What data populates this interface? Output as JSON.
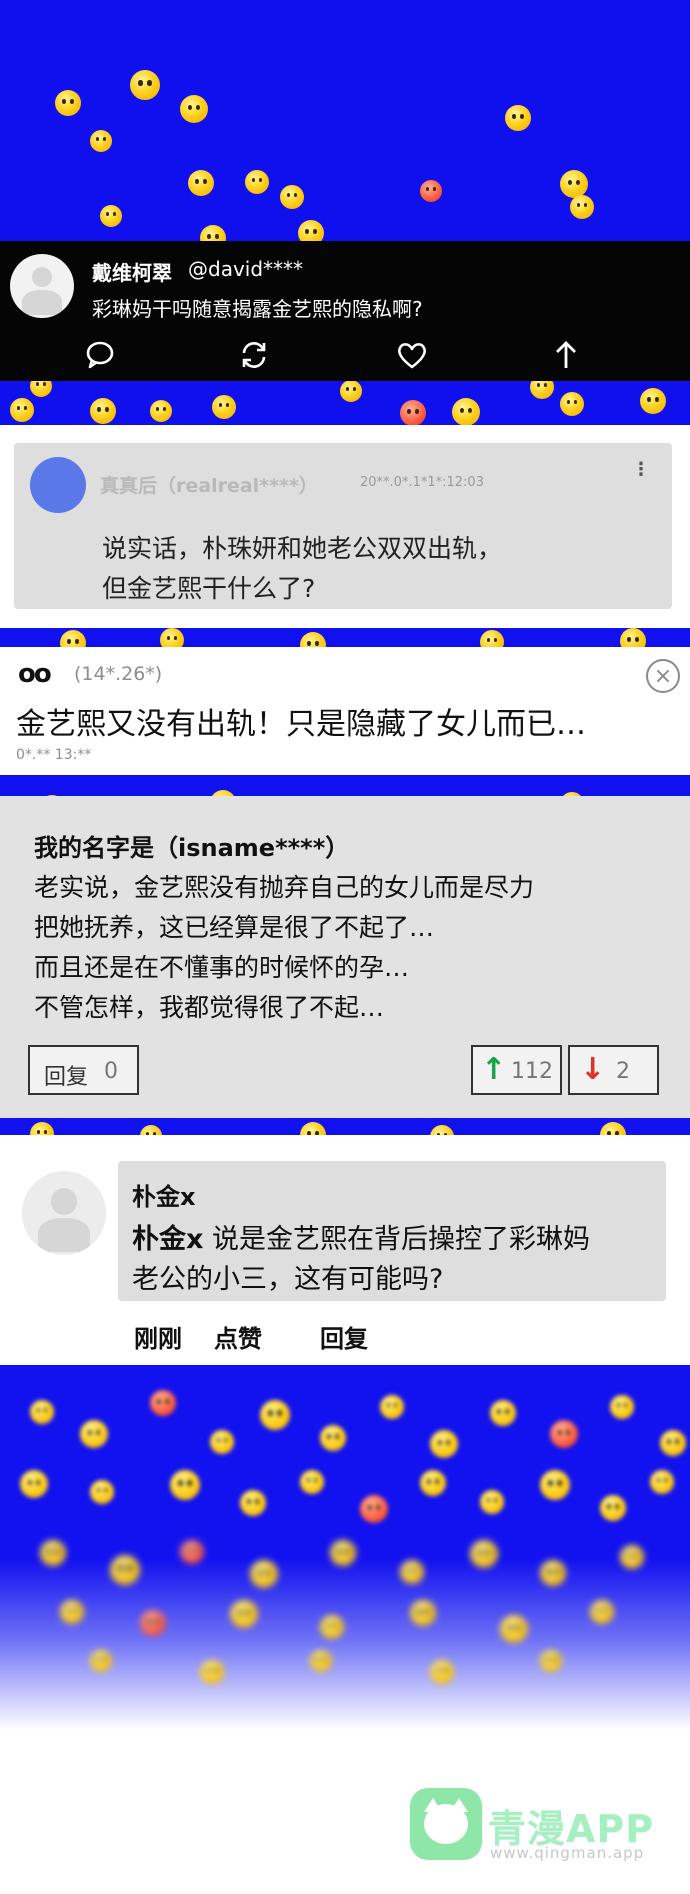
{
  "post1": {
    "name": "戴维柯翠",
    "handle": "@david****",
    "text": "彩琳妈干吗随意揭露金艺熙的隐私啊?",
    "actions": [
      "comment-icon",
      "repost-icon",
      "heart-icon",
      "share-icon"
    ]
  },
  "post2": {
    "name": "真真后（realreal****）",
    "timestamp": "20**.0*.1*1*:12:03",
    "more": "⋮",
    "lines": [
      "说实话，朴珠妍和她老公双双出轨，",
      "但金艺熙干什么了?"
    ]
  },
  "post3": {
    "nick": "oo",
    "meta": "(14*.26*)",
    "title": "金艺熙又没有出轨！只是隐藏了女儿而已…",
    "date": "0*.** 13:**",
    "close": "×"
  },
  "post4": {
    "name": "我的名字是（isname****）",
    "lines": [
      "老实说，金艺熙没有抛弃自己的女儿而是尽力",
      "把她抚养，这已经算是很了不起了…",
      "而且还是在不懂事的时候怀的孕…",
      "不管怎样，我都觉得很了不起…"
    ],
    "reply_label": "回复",
    "reply_count": "0",
    "up_arrow": "↑",
    "up_count": "112",
    "down_arrow": "↓",
    "down_count": "2"
  },
  "post5": {
    "name": "朴金x",
    "line1_name": "朴金x",
    "line1_rest": " 说是金艺熙在背后操控了彩琳妈",
    "line2": "老公的小三，这有可能吗?",
    "time": "刚刚",
    "like": "点赞",
    "reply": "回复"
  },
  "watermark": {
    "title": "青漫APP",
    "url": "www.qingman.app"
  },
  "colors": {
    "background_blue": "#1010ee",
    "emoji_yellow": "#ffd21f",
    "avatar_blue": "#5b78e8",
    "up_green": "#19a34a",
    "down_red": "#e0322d",
    "watermark_green": "#8ee7a8"
  }
}
